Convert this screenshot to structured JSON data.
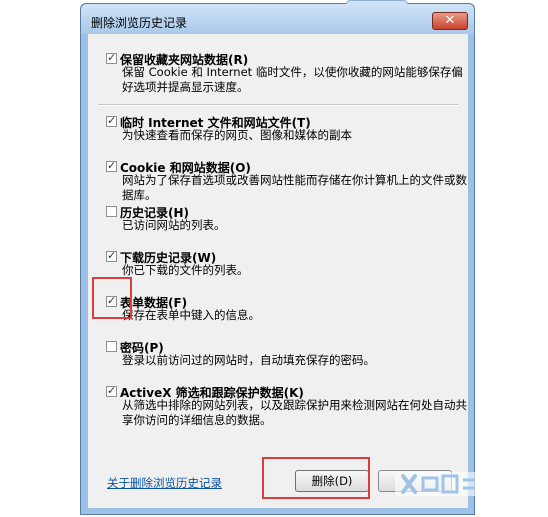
{
  "window": {
    "title": "删除浏览历史记录",
    "close_glyph": "✕"
  },
  "items": [
    {
      "label": "保留收藏夹网站数据(R)",
      "checked": true,
      "desc": "保留 Cookie 和 Internet 临时文件，以使你收藏的网站能够保存偏好选项并提高显示速度。"
    },
    {
      "label": "临时 Internet 文件和网站文件(T)",
      "checked": true,
      "desc": "为快速查看而保存的网页、图像和媒体的副本"
    },
    {
      "label": "Cookie 和网站数据(O)",
      "checked": true,
      "desc": "网站为了保存首选项或改善网站性能而存储在你计算机上的文件或数据库。"
    },
    {
      "label": "历史记录(H)",
      "checked": false,
      "desc": "已访问网站的列表。"
    },
    {
      "label": "下载历史记录(W)",
      "checked": true,
      "desc": "你已下载的文件的列表。"
    },
    {
      "label": "表单数据(F)",
      "checked": true,
      "desc": "保存在表单中键入的信息。"
    },
    {
      "label": "密码(P)",
      "checked": false,
      "desc": "登录以前访问过的网站时，自动填充保存的密码。"
    },
    {
      "label": "ActiveX 筛选和跟踪保护数据(K)",
      "checked": true,
      "desc": "从筛选中排除的网站列表，以及跟踪保护用来检测网站在何处自动共享你访问的详细信息的数据。"
    }
  ],
  "footer": {
    "link": "关于删除浏览历史记录",
    "delete_button": "删除(D)"
  },
  "colors": {
    "highlight": "#e03b3b",
    "link": "#0a53a1"
  }
}
